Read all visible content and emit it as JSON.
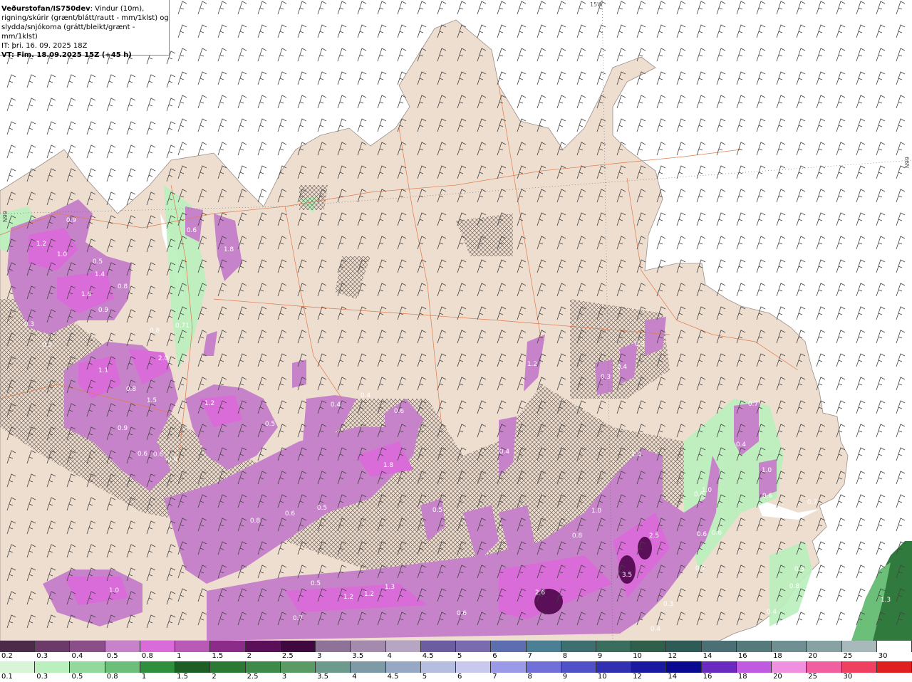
{
  "header": {
    "source": "Veðurstofan/IS750dev",
    "line1": ": Vindur (10m),",
    "line2": "rigning/skúrir (grænt/blátt/rautt - mm/1klst) og",
    "line3": "slydda/snjókoma (grátt/bleikt/grænt - mm/1klst)",
    "it": "IT: þri. 16. 09. 2025 18Z",
    "vt": "VT: Fim. 18.09.2025 15Z (+45 h)"
  },
  "geo_labels": {
    "lon": "15W",
    "lat": "66N",
    "lat_left": "66N"
  },
  "colors": {
    "sea": "#ffffff",
    "land": "#eeded0",
    "snow_light": "#c783c9",
    "snow_mid": "#d96cd8",
    "snow_dark": "#6a3a69",
    "rain_light": "#b9f0bd",
    "rain_dark": "#2f7a3c",
    "roads": "#e07a4a"
  },
  "map_values": [
    "0.9",
    "1.2",
    "1.0",
    "0.5",
    "1.4",
    "1.6",
    "0.8",
    "0.9",
    "0.3",
    "0.5",
    "0.6",
    "1.8",
    "0.71",
    "0.8",
    "2.0",
    "1.1",
    "0.8",
    "1.5",
    "0.9",
    "1.2",
    "0.6",
    "0.6",
    "0.5",
    "0.9",
    "0.4",
    "0.4",
    "0.6",
    "1.8",
    "0.6",
    "0.5",
    "0.5",
    "1.0",
    "0.8",
    "0.5",
    "1.2",
    "1.2",
    "1.3",
    "0.7",
    "0.6",
    "1.0",
    "2.6",
    "2.5",
    "3.5",
    "0.3",
    "0.4",
    "1.4",
    "0.8",
    "0.3",
    "0.4",
    "0.3",
    "1.2",
    "0.4",
    "0.7",
    "0.4",
    "1.0",
    "0.6",
    "0.6",
    "0.7",
    "0.6",
    "1.0",
    "0.7",
    "0.6",
    "1.3",
    "0.3",
    "0.8",
    "0.4"
  ],
  "legend_top": {
    "colors": [
      "#4b2a4a",
      "#6a3a69",
      "#8a4f89",
      "#c783c9",
      "#d96cd8",
      "#b85ab6",
      "#8d2b8b",
      "#5a0f58",
      "#3f083e",
      "#8f7298",
      "#a48bad",
      "#b7a5c4",
      "#6c5da0",
      "#7a6bb0",
      "#5c6db0",
      "#4b7f96",
      "#3e6f70",
      "#3a6d5e",
      "#2f5e4b",
      "#2d5c56",
      "#4c6f76",
      "#547a7c",
      "#6f8f92",
      "#87a2a3",
      "#a7b9bb",
      "#ffffff"
    ],
    "labels": [
      "0.2",
      "0.3",
      "0.4",
      "0.5",
      "0.8",
      "1",
      "1.5",
      "2",
      "2.5",
      "3",
      "3.5",
      "4",
      "4.5",
      "5",
      "6",
      "7",
      "8",
      "9",
      "10",
      "12",
      "14",
      "16",
      "18",
      "20",
      "25",
      "30"
    ]
  },
  "legend_bottom": {
    "colors": [
      "#d8f5d8",
      "#b9f0bd",
      "#93d99c",
      "#6bbf78",
      "#2f8f3c",
      "#1c5e24",
      "#2a7a34",
      "#3e8a48",
      "#5a9a64",
      "#6c9a8c",
      "#7e9aa6",
      "#97a8c4",
      "#b5bde0",
      "#c9c9f0",
      "#9a9ae8",
      "#7070d8",
      "#5050c8",
      "#3030b0",
      "#1a1aa0",
      "#0a0a90",
      "#6a2ac0",
      "#c05ae0",
      "#f090e0",
      "#f060a0",
      "#f04060",
      "#e02020"
    ],
    "labels": [
      "0.1",
      "0.3",
      "0.5",
      "0.8",
      "1",
      "1.5",
      "2",
      "2.5",
      "3",
      "3.5",
      "4",
      "4.5",
      "5",
      "6",
      "7",
      "8",
      "9",
      "10",
      "12",
      "14",
      "16",
      "18",
      "20",
      "25",
      "30"
    ]
  }
}
